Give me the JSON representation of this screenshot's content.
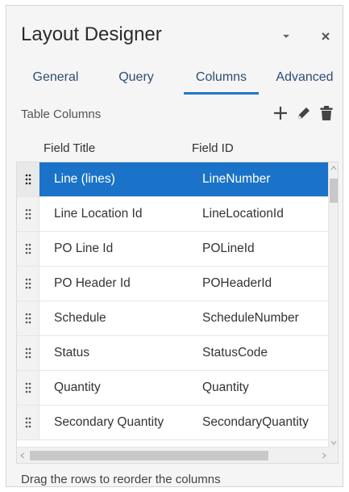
{
  "panel": {
    "title": "Layout Designer",
    "menu_icon": "chevron-down-icon",
    "close_icon": "close-icon"
  },
  "tabs": [
    {
      "label": "General",
      "active": false
    },
    {
      "label": "Query",
      "active": false
    },
    {
      "label": "Columns",
      "active": true
    },
    {
      "label": "Advanced",
      "active": false
    }
  ],
  "table_section": {
    "label": "Table Columns",
    "add_icon": "plus-icon",
    "edit_icon": "pencil-icon",
    "delete_icon": "trash-icon"
  },
  "columns": {
    "headers": [
      "Field Title",
      "Field ID"
    ],
    "rows": [
      {
        "title": "Line (lines)",
        "field_id": "LineNumber",
        "selected": true
      },
      {
        "title": "Line Location Id",
        "field_id": "LineLocationId",
        "selected": false
      },
      {
        "title": "PO Line Id",
        "field_id": "POLineId",
        "selected": false
      },
      {
        "title": "PO Header Id",
        "field_id": "POHeaderId",
        "selected": false
      },
      {
        "title": "Schedule",
        "field_id": "ScheduleNumber",
        "selected": false
      },
      {
        "title": "Status",
        "field_id": "StatusCode",
        "selected": false
      },
      {
        "title": "Quantity",
        "field_id": "Quantity",
        "selected": false
      },
      {
        "title": "Secondary Quantity",
        "field_id": "SecondaryQuantity",
        "selected": false
      }
    ]
  },
  "footer": {
    "hint": "Drag the rows to reorder the columns"
  },
  "colors": {
    "accent": "#1e78c8",
    "selected_row": "#1a73c8",
    "tab_text": "#2e4d74"
  }
}
